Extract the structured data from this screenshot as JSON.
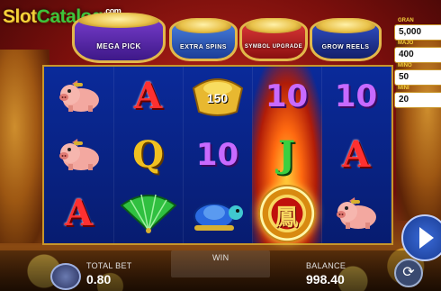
{
  "watermark": {
    "slot": "Slot",
    "catalog": "Catalog",
    "com": ".com"
  },
  "logo_sub": "",
  "pots": [
    {
      "label": "MEGA PICK"
    },
    {
      "label": "EXTRA SPINS"
    },
    {
      "label": "SYMBOL UPGRADE"
    },
    {
      "label": "GROW REELS"
    }
  ],
  "jackpots": [
    {
      "label": "GRAN",
      "value": "5,000"
    },
    {
      "label": "MAJO",
      "value": "400"
    },
    {
      "label": "MINO",
      "value": "50"
    },
    {
      "label": "MINI",
      "value": "20"
    }
  ],
  "reels": [
    [
      "pig",
      "pig",
      "A"
    ],
    [
      "A",
      "Q",
      "fan"
    ],
    [
      "ingot",
      "10",
      "turtle"
    ],
    [
      "10",
      "J",
      "coin"
    ],
    [
      "10",
      "A",
      "pig"
    ]
  ],
  "ingot_value": "150",
  "coin_char": "鳳",
  "bottom": {
    "total_bet_label": "TOTAL BET",
    "total_bet_value": "0.80",
    "win_label": "WIN",
    "balance_label": "BALANCE",
    "balance_value": "998.40"
  },
  "colors": {
    "reel_bg": "#0a2a9a",
    "frame": "#c8962a",
    "highlight": "#ff6a10"
  }
}
